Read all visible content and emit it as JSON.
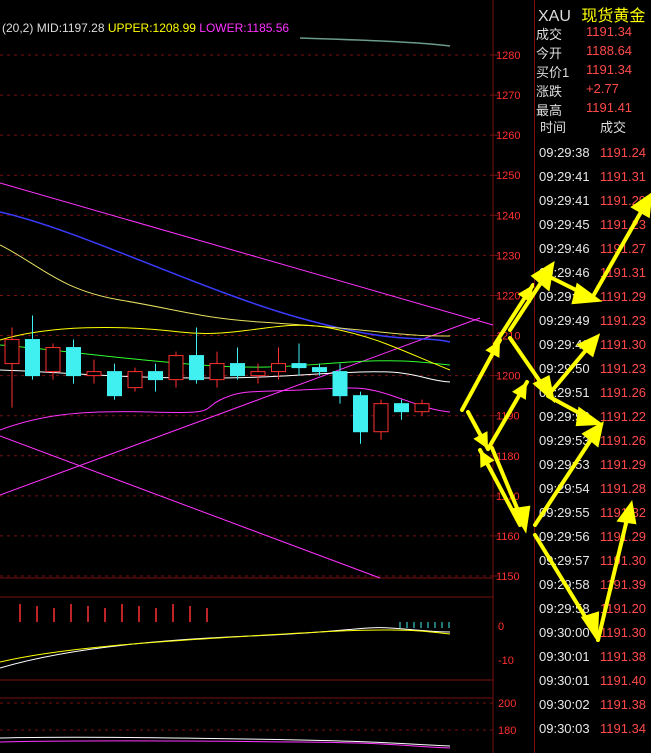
{
  "indicator": {
    "name": "(20,2)",
    "mid": "MID:1197.28",
    "upper": "UPPER:1208.99",
    "lower": "LOWER:1185.56"
  },
  "colors": {
    "up_candle": "#ff3030",
    "down_candle": "#40f0f0",
    "mid_line": "#ffffff",
    "upper_line": "#ffff00",
    "lower_line": "#ff00ff",
    "grid": "#7a1010",
    "price_text": "#ff3030",
    "arrow": "#ffff00"
  },
  "price_axis": {
    "ticks": [
      "1280",
      "1270",
      "1260",
      "1250",
      "1240",
      "1230",
      "1220",
      "1210",
      "1200",
      "1190",
      "1180",
      "1170",
      "1160",
      "1150"
    ],
    "min": 1150,
    "max": 1280
  },
  "sub1_axis": {
    "ticks": [
      "0",
      "-10"
    ]
  },
  "sub2_axis": {
    "ticks": [
      "200",
      "180"
    ]
  },
  "candles": [
    {
      "o": 1203,
      "c": 1209,
      "h": 1212,
      "l": 1192
    },
    {
      "o": 1209,
      "c": 1200,
      "h": 1215,
      "l": 1199
    },
    {
      "o": 1201,
      "c": 1207,
      "h": 1208,
      "l": 1199
    },
    {
      "o": 1207,
      "c": 1200,
      "h": 1209,
      "l": 1198
    },
    {
      "o": 1200,
      "c": 1201,
      "h": 1204,
      "l": 1198
    },
    {
      "o": 1201,
      "c": 1195,
      "h": 1203,
      "l": 1194
    },
    {
      "o": 1197,
      "c": 1201,
      "h": 1202,
      "l": 1196
    },
    {
      "o": 1201,
      "c": 1199,
      "h": 1203,
      "l": 1196
    },
    {
      "o": 1199,
      "c": 1205,
      "h": 1206,
      "l": 1197
    },
    {
      "o": 1205,
      "c": 1199,
      "h": 1212,
      "l": 1198
    },
    {
      "o": 1199,
      "c": 1203,
      "h": 1206,
      "l": 1197
    },
    {
      "o": 1203,
      "c": 1200,
      "h": 1207,
      "l": 1199
    },
    {
      "o": 1200,
      "c": 1201,
      "h": 1203,
      "l": 1198
    },
    {
      "o": 1201,
      "c": 1203,
      "h": 1207,
      "l": 1199
    },
    {
      "o": 1203,
      "c": 1202,
      "h": 1208,
      "l": 1200
    },
    {
      "o": 1202,
      "c": 1201,
      "h": 1203,
      "l": 1200
    },
    {
      "o": 1201,
      "c": 1195,
      "h": 1203,
      "l": 1193
    },
    {
      "o": 1195,
      "c": 1186,
      "h": 1196,
      "l": 1183
    },
    {
      "o": 1186,
      "c": 1193,
      "h": 1194,
      "l": 1184
    },
    {
      "o": 1193,
      "c": 1191,
      "h": 1194,
      "l": 1189
    },
    {
      "o": 1191,
      "c": 1193,
      "h": 1194,
      "l": 1190
    }
  ],
  "panel": {
    "symbol": "XAU",
    "name": "现货黄金",
    "info": [
      {
        "k": "成交",
        "v": "1191.34"
      },
      {
        "k": "今开",
        "v": "1188.64"
      },
      {
        "k": "买价1",
        "v": "1191.34"
      },
      {
        "k": "涨跌",
        "v": "+2.77"
      },
      {
        "k": "最高",
        "v": "1191.41"
      }
    ],
    "col_time": "时间",
    "col_price": "成交",
    "trades": [
      {
        "t": "09:29:38",
        "p": "1191.24"
      },
      {
        "t": "09:29:41",
        "p": "1191.31"
      },
      {
        "t": "09:29:41",
        "p": "1191.29"
      },
      {
        "t": "09:29:45",
        "p": "1191.23"
      },
      {
        "t": "09:29:46",
        "p": "1191.27"
      },
      {
        "t": "09:29:46",
        "p": "1191.31"
      },
      {
        "t": "09:29:47",
        "p": "1191.29"
      },
      {
        "t": "09:29:49",
        "p": "1191.23"
      },
      {
        "t": "09:29:49",
        "p": "1191.30"
      },
      {
        "t": "09:29:50",
        "p": "1191.23"
      },
      {
        "t": "09:29:51",
        "p": "1191.26"
      },
      {
        "t": "09:29:52",
        "p": "1191.22"
      },
      {
        "t": "09:29:53",
        "p": "1191.26"
      },
      {
        "t": "09:29:53",
        "p": "1191.29"
      },
      {
        "t": "09:29:54",
        "p": "1191.28"
      },
      {
        "t": "09:29:55",
        "p": "1191.32"
      },
      {
        "t": "09:29:56",
        "p": "1191.29"
      },
      {
        "t": "09:29:57",
        "p": "1191.30"
      },
      {
        "t": "09:29:58",
        "p": "1191.39"
      },
      {
        "t": "09:29:58",
        "p": "1191.20"
      },
      {
        "t": "09:30:00",
        "p": "1191.30"
      },
      {
        "t": "09:30:01",
        "p": "1191.38"
      },
      {
        "t": "09:30:01",
        "p": "1191.40"
      },
      {
        "t": "09:30:02",
        "p": "1191.38"
      },
      {
        "t": "09:30:03",
        "p": "1191.34"
      }
    ]
  }
}
